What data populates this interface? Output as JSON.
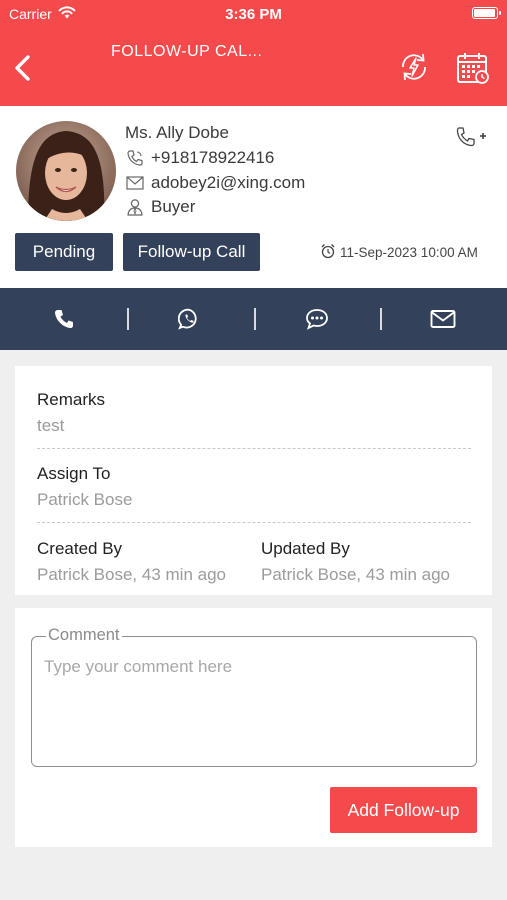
{
  "status_bar": {
    "carrier": "Carrier",
    "time": "3:36 PM",
    "battery_level": 1.0
  },
  "header": {
    "title": "FOLLOW-UP CAL...",
    "icons": [
      "back-icon",
      "sync-bolt-icon",
      "calendar-icon"
    ]
  },
  "contact": {
    "name": "Ms. Ally Dobe",
    "phone": "+918178922416",
    "email": "adobey2i@xing.com",
    "role": "Buyer",
    "status": "Pending",
    "type": "Follow-up Call",
    "datetime": "11-Sep-2023 10:00 AM"
  },
  "actions": [
    "phone-icon",
    "whatsapp-icon",
    "sms-icon",
    "email-icon"
  ],
  "details": {
    "remarks_label": "Remarks",
    "remarks_value": "test",
    "assign_label": "Assign To",
    "assign_value": "Patrick Bose",
    "created_label": "Created By",
    "created_value": "Patrick Bose, 43 min ago",
    "updated_label": "Updated By",
    "updated_value": "Patrick Bose, 43 min ago"
  },
  "comment": {
    "legend": "Comment",
    "placeholder": "Type your comment here",
    "value": "",
    "submit_label": "Add Follow-up"
  },
  "colors": {
    "accent": "#f44a4c",
    "navy": "#33415a",
    "background": "#efefef"
  }
}
